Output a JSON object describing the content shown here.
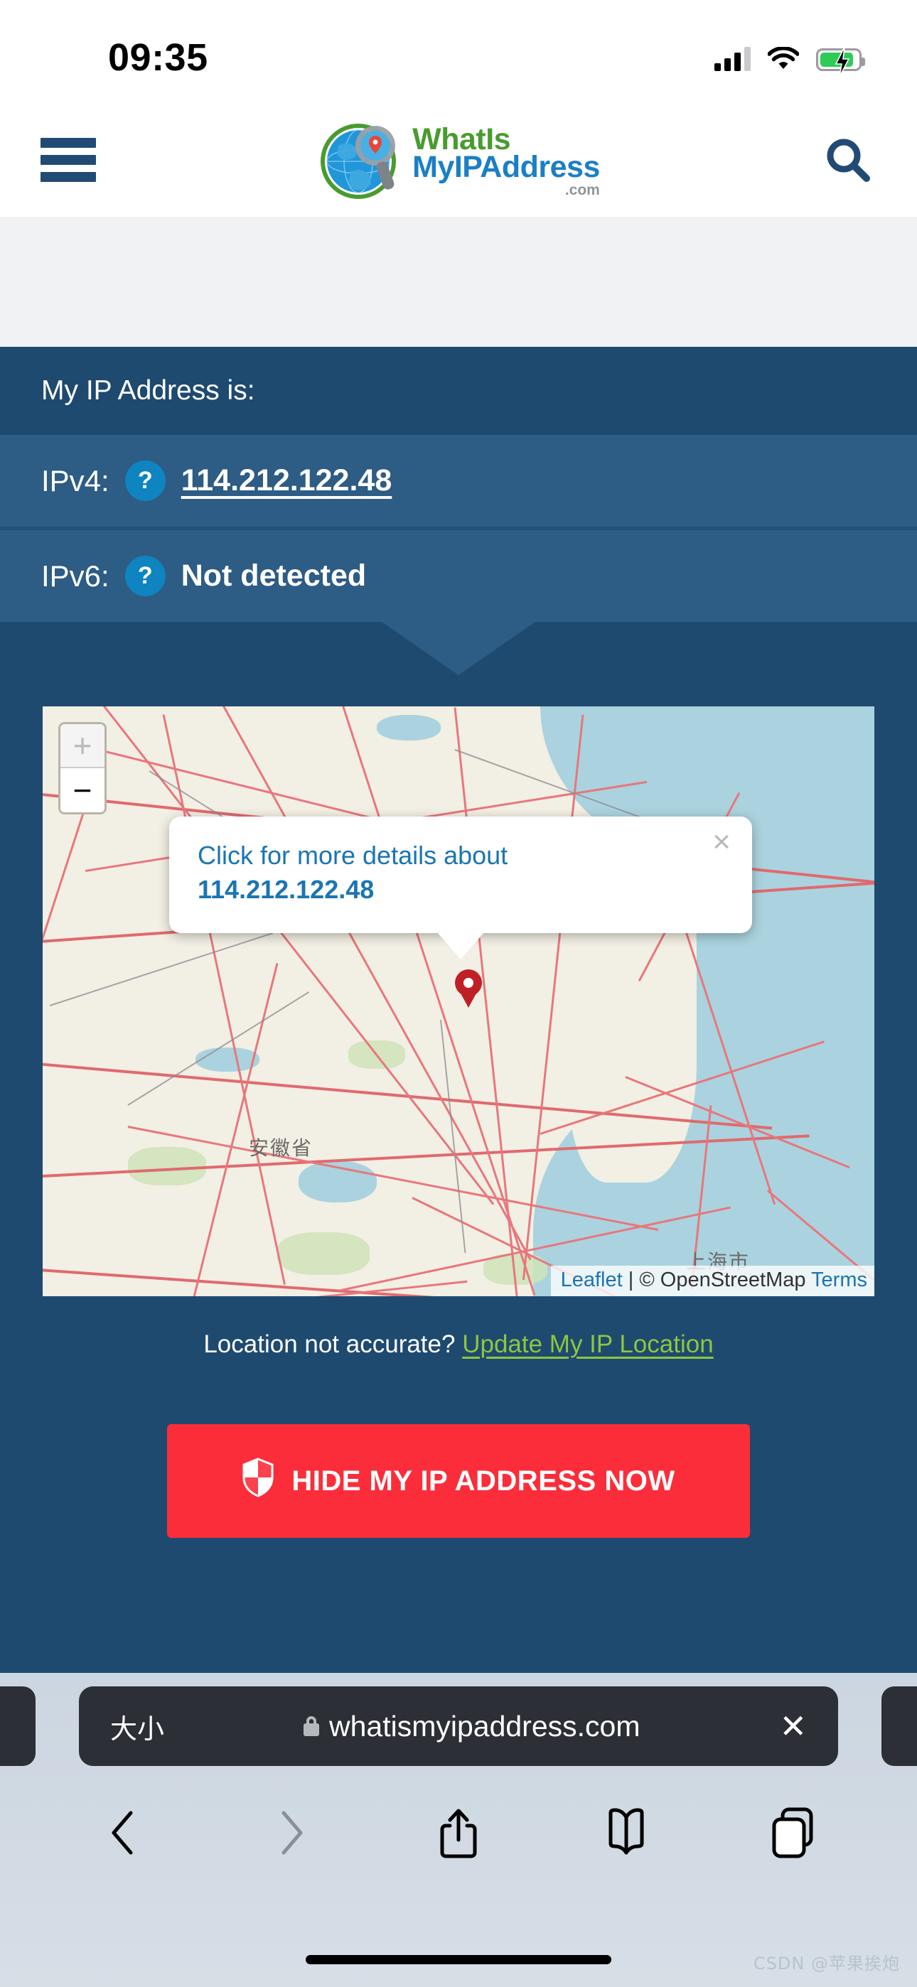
{
  "status_bar": {
    "time": "09:35",
    "cellular_icon": "cellular-signal-icon",
    "wifi_icon": "wifi-icon",
    "battery_icon": "battery-charging-icon",
    "battery_color": "#2ecc57"
  },
  "header": {
    "menu_icon": "hamburger-menu-icon",
    "search_icon": "search-icon",
    "logo": {
      "line1": "WhatIs",
      "line2": "MyIPAddress",
      "line3": ".com",
      "color1": "#4a9b2f",
      "color2": "#1b7fc4",
      "color3": "#8e9699"
    }
  },
  "ip_panel": {
    "title": "My IP Address is:",
    "rows": [
      {
        "label": "IPv4:",
        "badge": "?",
        "value": "114.212.122.48",
        "underlined": true
      },
      {
        "label": "IPv6:",
        "badge": "?",
        "value": "Not detected",
        "underlined": false
      }
    ],
    "bg_dark": "#1e4a70",
    "bg_light": "#2d5c85",
    "badge_color": "#0e84c0"
  },
  "map": {
    "zoom_in_label": "+",
    "zoom_out_label": "−",
    "popup": {
      "line1": "Click for more details about",
      "line2": "114.212.122.48",
      "close_label": "×"
    },
    "labels": [
      {
        "text": "安徽省"
      },
      {
        "text": "上海市"
      }
    ],
    "attribution": {
      "leaflet": "Leaflet",
      "separator": "|",
      "osm": "© OpenStreetMap",
      "terms": "Terms"
    }
  },
  "location_note": {
    "text": "Location not accurate?",
    "link": "Update My IP Location",
    "link_color": "#8dc63f"
  },
  "cta": {
    "label": "HIDE MY IP ADDRESS NOW",
    "icon": "shield-icon",
    "bg": "#fc2d3a"
  },
  "safari": {
    "text_size_label": "大小",
    "lock_icon": "lock-icon",
    "url": "whatismyipaddress.com",
    "close_label": "✕",
    "toolbar": {
      "back": "back-arrow-icon",
      "forward": "forward-arrow-icon",
      "share": "share-icon",
      "bookmarks": "bookmarks-icon",
      "tabs": "tabs-icon"
    }
  },
  "watermark": "CSDN @苹果挨炮"
}
